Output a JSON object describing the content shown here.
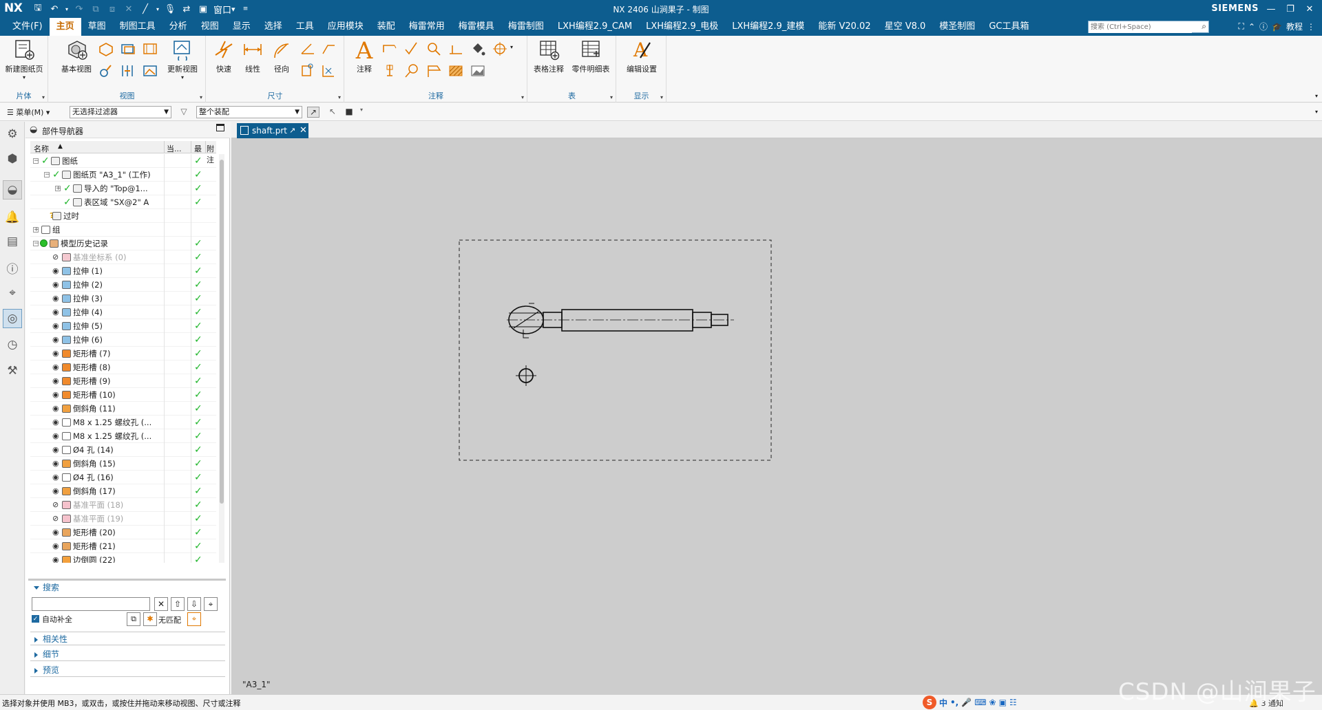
{
  "titlebar": {
    "logo": "NX",
    "window_menu": "窗口",
    "title": "NX 2406 山涧果子 - 制图",
    "brand": "SIEMENS"
  },
  "menubar": {
    "tabs": [
      "文件(F)",
      "主页",
      "草图",
      "制图工具",
      "分析",
      "视图",
      "显示",
      "选择",
      "工具",
      "应用模块",
      "装配",
      "梅雷常用",
      "梅雷模具",
      "梅雷制图",
      "LXH编程2.9_CAM",
      "LXH编程2.9_电极",
      "LXH编程2.9_建模",
      "能新 V20.02",
      "星空 V8.0",
      "模圣制图",
      "GC工具箱"
    ],
    "active_tab": "主页",
    "search_placeholder": "搜索 (Ctrl+Space)",
    "tutorial": "教程"
  },
  "ribbon": {
    "groups": {
      "sheet": "片体",
      "view": "视图",
      "dimension": "尺寸",
      "annotation": "注释",
      "table": "表",
      "display": "显示"
    },
    "buttons": {
      "new_sheet": "新建图纸页",
      "base_view": "基本视图",
      "update_view": "更新视图",
      "rapid": "快速",
      "linear": "线性",
      "radial": "径向",
      "note": "注释",
      "tabular_note": "表格注释",
      "parts_list": "零件明细表",
      "edit_settings": "编辑设置"
    }
  },
  "toolbar": {
    "menu": "菜单(M)",
    "filter": "无选择过滤器",
    "scope": "整个装配"
  },
  "navigator": {
    "title": "部件导航器",
    "columns": [
      "名称",
      "当...",
      "最",
      "附注"
    ],
    "rows": [
      {
        "label": "图纸",
        "indent": 0,
        "expander": "-",
        "check": true,
        "tcheck": true,
        "icon": "folder",
        "eye": false
      },
      {
        "label": "图纸页 \"A3_1\" (工作)",
        "indent": 1,
        "expander": "-",
        "check": true,
        "tcheck": true,
        "icon": "sheet",
        "eye": false
      },
      {
        "label": "导入的 \"Top@1...",
        "indent": 2,
        "expander": "+",
        "check": true,
        "tcheck": true,
        "icon": "view",
        "eye": false
      },
      {
        "label": "表区域 \"SX@2\" A",
        "indent": 2,
        "expander": "",
        "check": true,
        "tcheck": true,
        "icon": "table",
        "eye": false
      },
      {
        "label": "过时",
        "indent": 1,
        "expander": "",
        "check": false,
        "tcheck": false,
        "icon": "folder",
        "eye": false
      },
      {
        "label": "组",
        "indent": 0,
        "expander": "+",
        "check": false,
        "tcheck": false,
        "icon": "group",
        "eye": false
      },
      {
        "label": "模型历史记录",
        "indent": 0,
        "expander": "-",
        "check": true,
        "tcheck": false,
        "icon": "history",
        "eye": false
      },
      {
        "label": "基准坐标系 (0)",
        "indent": 1,
        "expander": "",
        "check": true,
        "dim": true,
        "icon": "csys",
        "eye": true
      },
      {
        "label": "拉伸 (1)",
        "indent": 1,
        "expander": "",
        "check": true,
        "icon": "extrude",
        "eye": true
      },
      {
        "label": "拉伸 (2)",
        "indent": 1,
        "expander": "",
        "check": true,
        "icon": "extrude",
        "eye": true
      },
      {
        "label": "拉伸 (3)",
        "indent": 1,
        "expander": "",
        "check": true,
        "icon": "extrude",
        "eye": true
      },
      {
        "label": "拉伸 (4)",
        "indent": 1,
        "expander": "",
        "check": true,
        "icon": "extrude",
        "eye": true
      },
      {
        "label": "拉伸 (5)",
        "indent": 1,
        "expander": "",
        "check": true,
        "icon": "extrude",
        "eye": true
      },
      {
        "label": "拉伸 (6)",
        "indent": 1,
        "expander": "",
        "check": true,
        "icon": "extrude",
        "eye": true
      },
      {
        "label": "矩形槽 (7)",
        "indent": 1,
        "expander": "",
        "check": true,
        "icon": "groove",
        "eye": true
      },
      {
        "label": "矩形槽 (8)",
        "indent": 1,
        "expander": "",
        "check": true,
        "icon": "groove",
        "eye": true
      },
      {
        "label": "矩形槽 (9)",
        "indent": 1,
        "expander": "",
        "check": true,
        "icon": "groove",
        "eye": true
      },
      {
        "label": "矩形槽 (10)",
        "indent": 1,
        "expander": "",
        "check": true,
        "icon": "groove",
        "eye": true
      },
      {
        "label": "倒斜角 (11)",
        "indent": 1,
        "expander": "",
        "check": true,
        "icon": "chamfer",
        "eye": true
      },
      {
        "label": "M8 x 1.25 螺纹孔 (...",
        "indent": 1,
        "expander": "",
        "check": true,
        "icon": "hole",
        "eye": true
      },
      {
        "label": "M8 x 1.25 螺纹孔 (...",
        "indent": 1,
        "expander": "",
        "check": true,
        "icon": "hole",
        "eye": true
      },
      {
        "label": "Ø4 孔 (14)",
        "indent": 1,
        "expander": "",
        "check": true,
        "icon": "hole",
        "eye": true
      },
      {
        "label": "倒斜角 (15)",
        "indent": 1,
        "expander": "",
        "check": true,
        "icon": "chamfer",
        "eye": true
      },
      {
        "label": "Ø4 孔 (16)",
        "indent": 1,
        "expander": "",
        "check": true,
        "icon": "hole",
        "eye": true
      },
      {
        "label": "倒斜角 (17)",
        "indent": 1,
        "expander": "",
        "check": true,
        "icon": "chamfer",
        "eye": true
      },
      {
        "label": "基准平面 (18)",
        "indent": 1,
        "expander": "",
        "check": true,
        "dim": true,
        "icon": "plane",
        "eye": true
      },
      {
        "label": "基准平面 (19)",
        "indent": 1,
        "expander": "",
        "check": true,
        "dim": true,
        "icon": "plane",
        "eye": true
      },
      {
        "label": "矩形槽 (20)",
        "indent": 1,
        "expander": "",
        "check": true,
        "icon": "groove2",
        "eye": true
      },
      {
        "label": "矩形槽 (21)",
        "indent": 1,
        "expander": "",
        "check": true,
        "icon": "groove2",
        "eye": true
      },
      {
        "label": "边倒圆 (22)",
        "indent": 1,
        "expander": "",
        "check": true,
        "icon": "blend",
        "eye": true
      }
    ],
    "sections": {
      "search": "搜索",
      "auto_complete": "自动补全",
      "no_match": "无匹配",
      "dependencies": "相关性",
      "details": "细节",
      "preview": "预览"
    }
  },
  "document": {
    "tab": "shaft.prt",
    "sheet_label": "\"A3_1\""
  },
  "statusbar": {
    "message": "选择对象并使用 MB3，或双击，或按住并拖动来移动视图、尺寸或注释",
    "ime_lang": "中",
    "notice": "3 通知"
  },
  "watermark": "CSDN @山涧果子",
  "colors": {
    "brand_blue": "#0d5d8f",
    "active_tab": "#c66a00",
    "check_green": "#1fb52a",
    "link_blue": "#1e6aa1",
    "canvas": "#cdcdcd"
  }
}
